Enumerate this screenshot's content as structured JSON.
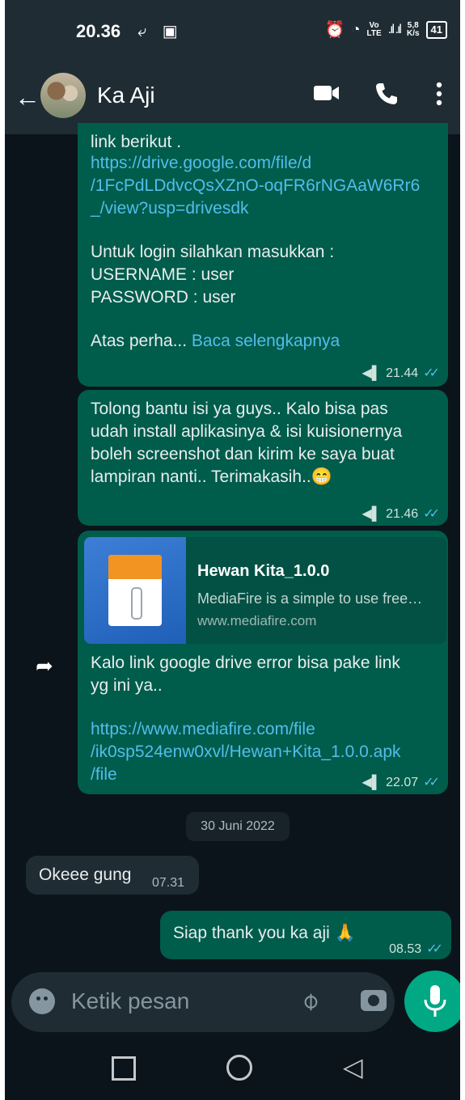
{
  "status_bar": {
    "time": "20.36",
    "network_speed": "5,8",
    "network_speed_unit": "K/s",
    "volte_top": "Vo",
    "volte_bottom": "LTE",
    "battery": "41"
  },
  "header": {
    "contact_name": "Ka Aji"
  },
  "messages": [
    {
      "type": "outgoing",
      "lines_top": "link berikut .",
      "link": "https://drive.google.com/file/d\n/1FcPdLDdvcQsXZnO-oqFR6rNGAaW6Rr6\n_/view?usp=drivesdk",
      "body": "Untuk login silahkan masukkan :\nUSERNAME : user\nPASSWORD : user",
      "tail_text": "Atas perha... ",
      "read_more": "Baca selengkapnya",
      "time": "21.44"
    },
    {
      "type": "outgoing",
      "text": "Tolong bantu isi ya guys.. Kalo bisa pas\nudah install aplikasinya & isi kuisionernya\nboleh screenshot dan kirim ke saya buat\nlampiran nanti.. Terimakasih..😁",
      "time": "21.46"
    },
    {
      "type": "outgoing",
      "preview_title": "Hewan Kita_1.0.0",
      "preview_desc": "MediaFire is a simple to use free…",
      "preview_site": "www.mediafire.com",
      "text": "Kalo link google drive error bisa pake link\nyg ini ya..",
      "link": "https://www.mediafire.com/file\n/ik0sp524enw0xvl/Hewan+Kita_1.0.0.apk\n/file",
      "time": "22.07"
    },
    {
      "type": "date",
      "text": "30 Juni 2022"
    },
    {
      "type": "incoming",
      "text": "Okeee gung",
      "time": "07.31"
    },
    {
      "type": "outgoing",
      "text": "Siap thank you ka aji 🙏",
      "time": "08.53"
    }
  ],
  "input": {
    "placeholder": "Ketik pesan"
  },
  "colors": {
    "background": "#0b141a",
    "outgoing_bubble": "#005c4b",
    "incoming_bubble": "#202c33",
    "link": "#53bdeb",
    "accent": "#00a884"
  },
  "icons": [
    "back-arrow-icon",
    "video-call-icon",
    "voice-call-icon",
    "more-options-icon",
    "forward-icon",
    "emoji-icon",
    "attach-icon",
    "camera-icon",
    "mic-icon",
    "recents-icon",
    "home-icon",
    "back-nav-icon"
  ]
}
